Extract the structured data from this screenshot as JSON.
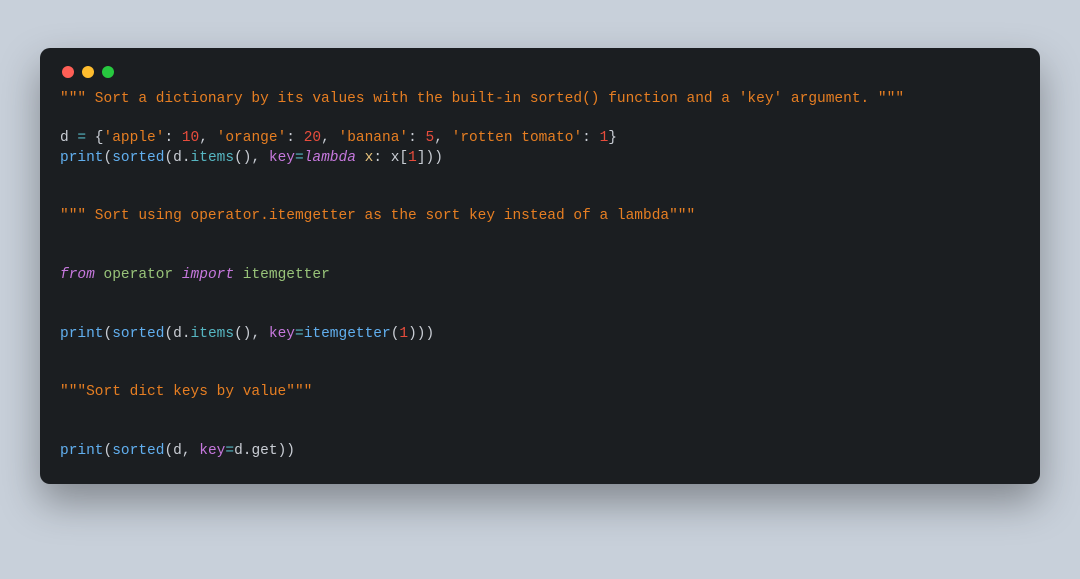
{
  "code": {
    "language": "python",
    "lines": [
      [
        {
          "t": "\"\"\" Sort a dictionary by its values with the built-in sorted() function and a 'key' argument. \"\"\"",
          "c": "str"
        }
      ],
      [],
      [
        {
          "t": "d ",
          "c": "def"
        },
        {
          "t": "=",
          "c": "mth"
        },
        {
          "t": " {",
          "c": "pnc"
        },
        {
          "t": "'apple'",
          "c": "str"
        },
        {
          "t": ": ",
          "c": "pnc"
        },
        {
          "t": "10",
          "c": "num"
        },
        {
          "t": ", ",
          "c": "pnc"
        },
        {
          "t": "'orange'",
          "c": "str"
        },
        {
          "t": ": ",
          "c": "pnc"
        },
        {
          "t": "20",
          "c": "num"
        },
        {
          "t": ", ",
          "c": "pnc"
        },
        {
          "t": "'banana'",
          "c": "str"
        },
        {
          "t": ": ",
          "c": "pnc"
        },
        {
          "t": "5",
          "c": "num"
        },
        {
          "t": ", ",
          "c": "pnc"
        },
        {
          "t": "'rotten tomato'",
          "c": "str"
        },
        {
          "t": ": ",
          "c": "pnc"
        },
        {
          "t": "1",
          "c": "num"
        },
        {
          "t": "}",
          "c": "pnc"
        }
      ],
      [
        {
          "t": "print",
          "c": "fn"
        },
        {
          "t": "(",
          "c": "pnc"
        },
        {
          "t": "sorted",
          "c": "fn"
        },
        {
          "t": "(d.",
          "c": "pnc"
        },
        {
          "t": "items",
          "c": "mth"
        },
        {
          "t": "(), ",
          "c": "pnc"
        },
        {
          "t": "key",
          "c": "par"
        },
        {
          "t": "=",
          "c": "mth"
        },
        {
          "t": "lambda",
          "c": "kw"
        },
        {
          "t": " ",
          "c": "pnc"
        },
        {
          "t": "x",
          "c": "cls"
        },
        {
          "t": ": x[",
          "c": "pnc"
        },
        {
          "t": "1",
          "c": "num"
        },
        {
          "t": "]))",
          "c": "pnc"
        }
      ],
      [],
      [],
      [
        {
          "t": "\"\"\" Sort using operator.itemgetter as the sort key instead of a lambda\"\"\"",
          "c": "str"
        }
      ],
      [],
      [],
      [
        {
          "t": "from",
          "c": "kw"
        },
        {
          "t": " ",
          "c": "pnc"
        },
        {
          "t": "operator",
          "c": "idn"
        },
        {
          "t": " ",
          "c": "pnc"
        },
        {
          "t": "import",
          "c": "kw"
        },
        {
          "t": " ",
          "c": "pnc"
        },
        {
          "t": "itemgetter",
          "c": "idn"
        }
      ],
      [],
      [],
      [
        {
          "t": "print",
          "c": "fn"
        },
        {
          "t": "(",
          "c": "pnc"
        },
        {
          "t": "sorted",
          "c": "fn"
        },
        {
          "t": "(d.",
          "c": "pnc"
        },
        {
          "t": "items",
          "c": "mth"
        },
        {
          "t": "(), ",
          "c": "pnc"
        },
        {
          "t": "key",
          "c": "par"
        },
        {
          "t": "=",
          "c": "mth"
        },
        {
          "t": "itemgetter",
          "c": "fn"
        },
        {
          "t": "(",
          "c": "pnc"
        },
        {
          "t": "1",
          "c": "num"
        },
        {
          "t": ")))",
          "c": "pnc"
        }
      ],
      [],
      [],
      [
        {
          "t": "\"\"\"Sort dict keys by value\"\"\"",
          "c": "str"
        }
      ],
      [],
      [],
      [
        {
          "t": "print",
          "c": "fn"
        },
        {
          "t": "(",
          "c": "pnc"
        },
        {
          "t": "sorted",
          "c": "fn"
        },
        {
          "t": "(d, ",
          "c": "pnc"
        },
        {
          "t": "key",
          "c": "par"
        },
        {
          "t": "=",
          "c": "mth"
        },
        {
          "t": "d.get))",
          "c": "pnc"
        }
      ]
    ]
  }
}
